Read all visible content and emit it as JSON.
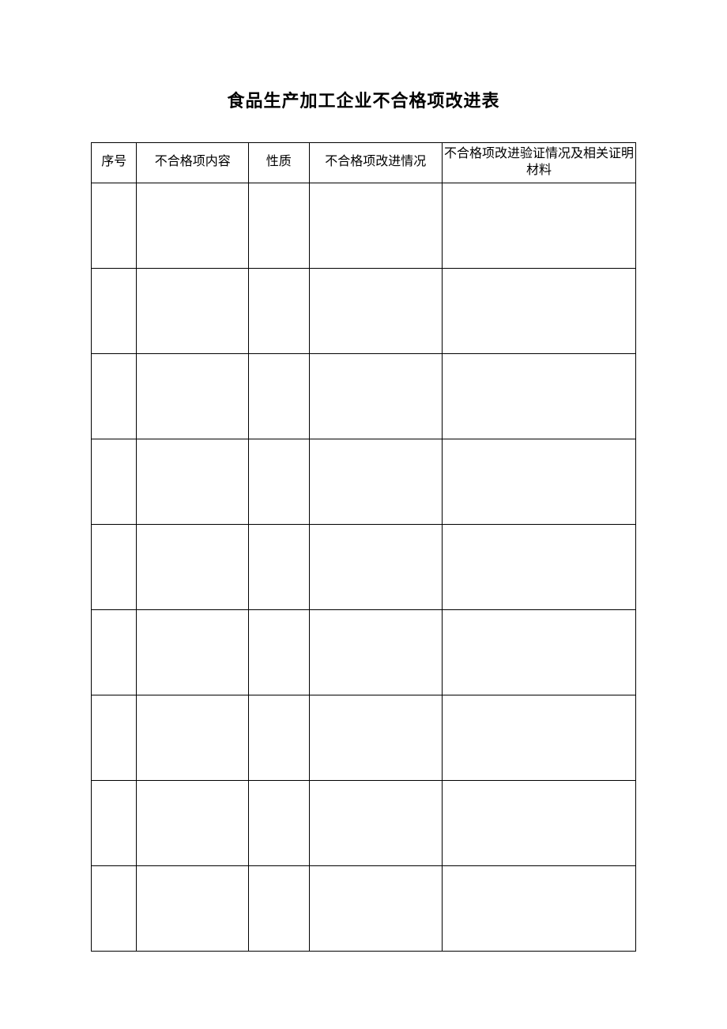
{
  "title": "食品生产加工企业不合格项改进表",
  "headers": {
    "seq": "序号",
    "content": "不合格项内容",
    "nature": "性质",
    "improvement": "不合格项改进情况",
    "verification": "不合格项改进验证情况及相关证明材料"
  },
  "rows": [
    {
      "seq": "",
      "content": "",
      "nature": "",
      "improvement": "",
      "verification": ""
    },
    {
      "seq": "",
      "content": "",
      "nature": "",
      "improvement": "",
      "verification": ""
    },
    {
      "seq": "",
      "content": "",
      "nature": "",
      "improvement": "",
      "verification": ""
    },
    {
      "seq": "",
      "content": "",
      "nature": "",
      "improvement": "",
      "verification": ""
    },
    {
      "seq": "",
      "content": "",
      "nature": "",
      "improvement": "",
      "verification": ""
    },
    {
      "seq": "",
      "content": "",
      "nature": "",
      "improvement": "",
      "verification": ""
    },
    {
      "seq": "",
      "content": "",
      "nature": "",
      "improvement": "",
      "verification": ""
    },
    {
      "seq": "",
      "content": "",
      "nature": "",
      "improvement": "",
      "verification": ""
    },
    {
      "seq": "",
      "content": "",
      "nature": "",
      "improvement": "",
      "verification": ""
    }
  ]
}
